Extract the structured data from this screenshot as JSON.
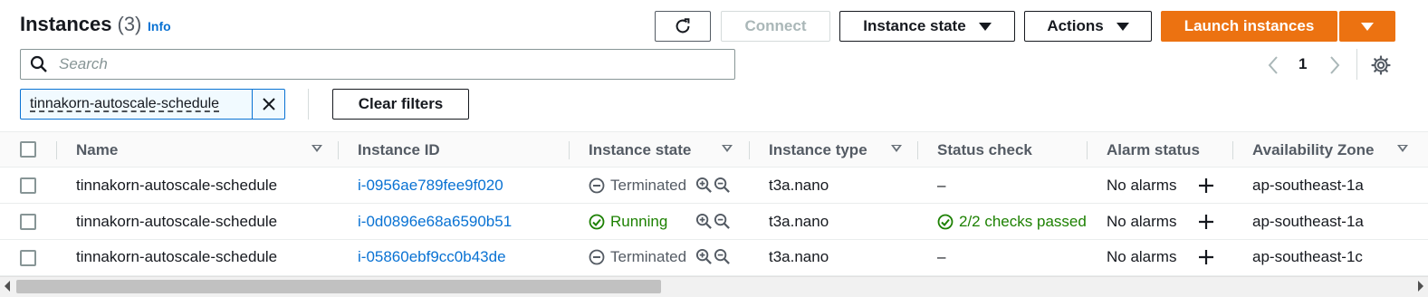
{
  "header": {
    "title": "Instances",
    "count": "(3)",
    "info_label": "Info"
  },
  "toolbar": {
    "refresh_icon": "refresh-icon",
    "connect_label": "Connect",
    "instance_state_label": "Instance state",
    "actions_label": "Actions",
    "launch_label": "Launch instances"
  },
  "search": {
    "placeholder": "Search",
    "value": ""
  },
  "pagination": {
    "current_page": "1"
  },
  "filters": {
    "token": "tinnakorn-autoscale-schedule",
    "clear_label": "Clear filters"
  },
  "table": {
    "columns": [
      "Name",
      "Instance ID",
      "Instance state",
      "Instance type",
      "Status check",
      "Alarm status",
      "Availability Zone"
    ],
    "rows": [
      {
        "name": "tinnakorn-autoscale-schedule",
        "instance_id": "i-0956ae789fee9f020",
        "state": "Terminated",
        "type": "t3a.nano",
        "status_check": "–",
        "alarm": "No alarms",
        "az": "ap-southeast-1a"
      },
      {
        "name": "tinnakorn-autoscale-schedule",
        "instance_id": "i-0d0896e68a6590b51",
        "state": "Running",
        "type": "t3a.nano",
        "status_check": "2/2 checks passed",
        "alarm": "No alarms",
        "az": "ap-southeast-1a"
      },
      {
        "name": "tinnakorn-autoscale-schedule",
        "instance_id": "i-05860ebf9cc0b43de",
        "state": "Terminated",
        "type": "t3a.nano",
        "status_check": "–",
        "alarm": "No alarms",
        "az": "ap-southeast-1c"
      }
    ]
  },
  "colors": {
    "primary": "#ec7211",
    "link": "#0972d3",
    "success": "#1d8102",
    "muted": "#545b64"
  }
}
